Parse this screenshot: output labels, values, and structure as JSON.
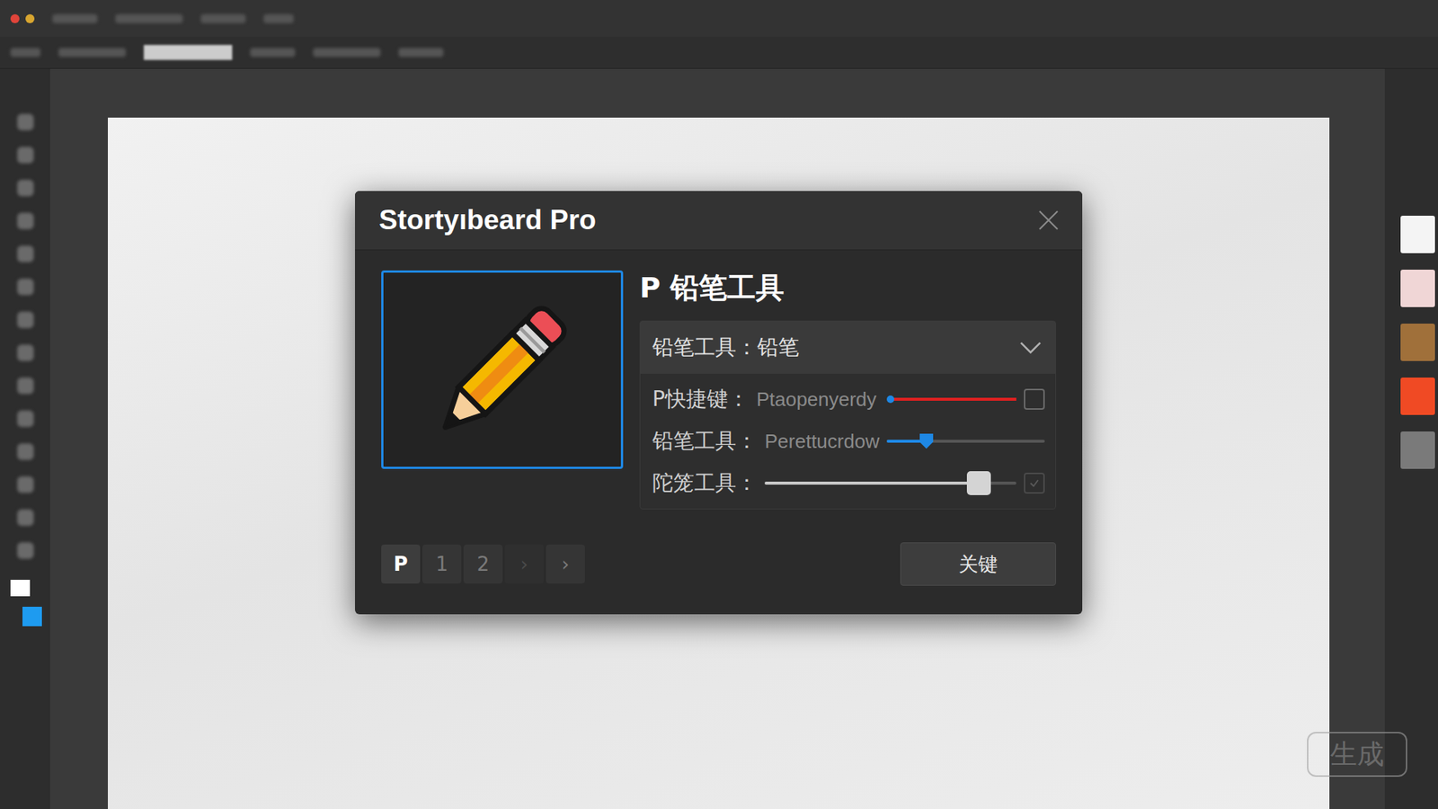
{
  "app": {
    "swatches": [
      {
        "color": "#f4f4f4"
      },
      {
        "color": "#f0d6d6"
      },
      {
        "color": "#a0703a"
      },
      {
        "color": "#f04a24"
      },
      {
        "color": "#7a7a7a"
      }
    ]
  },
  "dialog": {
    "title": "Stortyıbeard Pro",
    "heading": "P 铅笔工具",
    "dropdown": {
      "value": "铅笔工具：铅笔",
      "expanded": true
    },
    "rows": [
      {
        "kind": "red-slider",
        "label": "P快捷键：",
        "value": "Ptaopenyerdy",
        "level": 0.05,
        "checked": false
      },
      {
        "kind": "blue-slider",
        "label": "铅笔工具：",
        "value": "Perettucrdow",
        "level": 0.25
      },
      {
        "kind": "grey-slider",
        "label": "陀笼工具：",
        "level": 0.85,
        "checked": true
      }
    ],
    "pagination": [
      {
        "label": "P",
        "selected": true,
        "disabled": false
      },
      {
        "label": "1",
        "selected": false,
        "disabled": false
      },
      {
        "label": "2",
        "selected": false,
        "disabled": false
      },
      {
        "label": "›",
        "selected": false,
        "disabled": true
      },
      {
        "label": "›",
        "selected": false,
        "disabled": false
      }
    ],
    "button": "关键"
  },
  "watermark": "生成"
}
